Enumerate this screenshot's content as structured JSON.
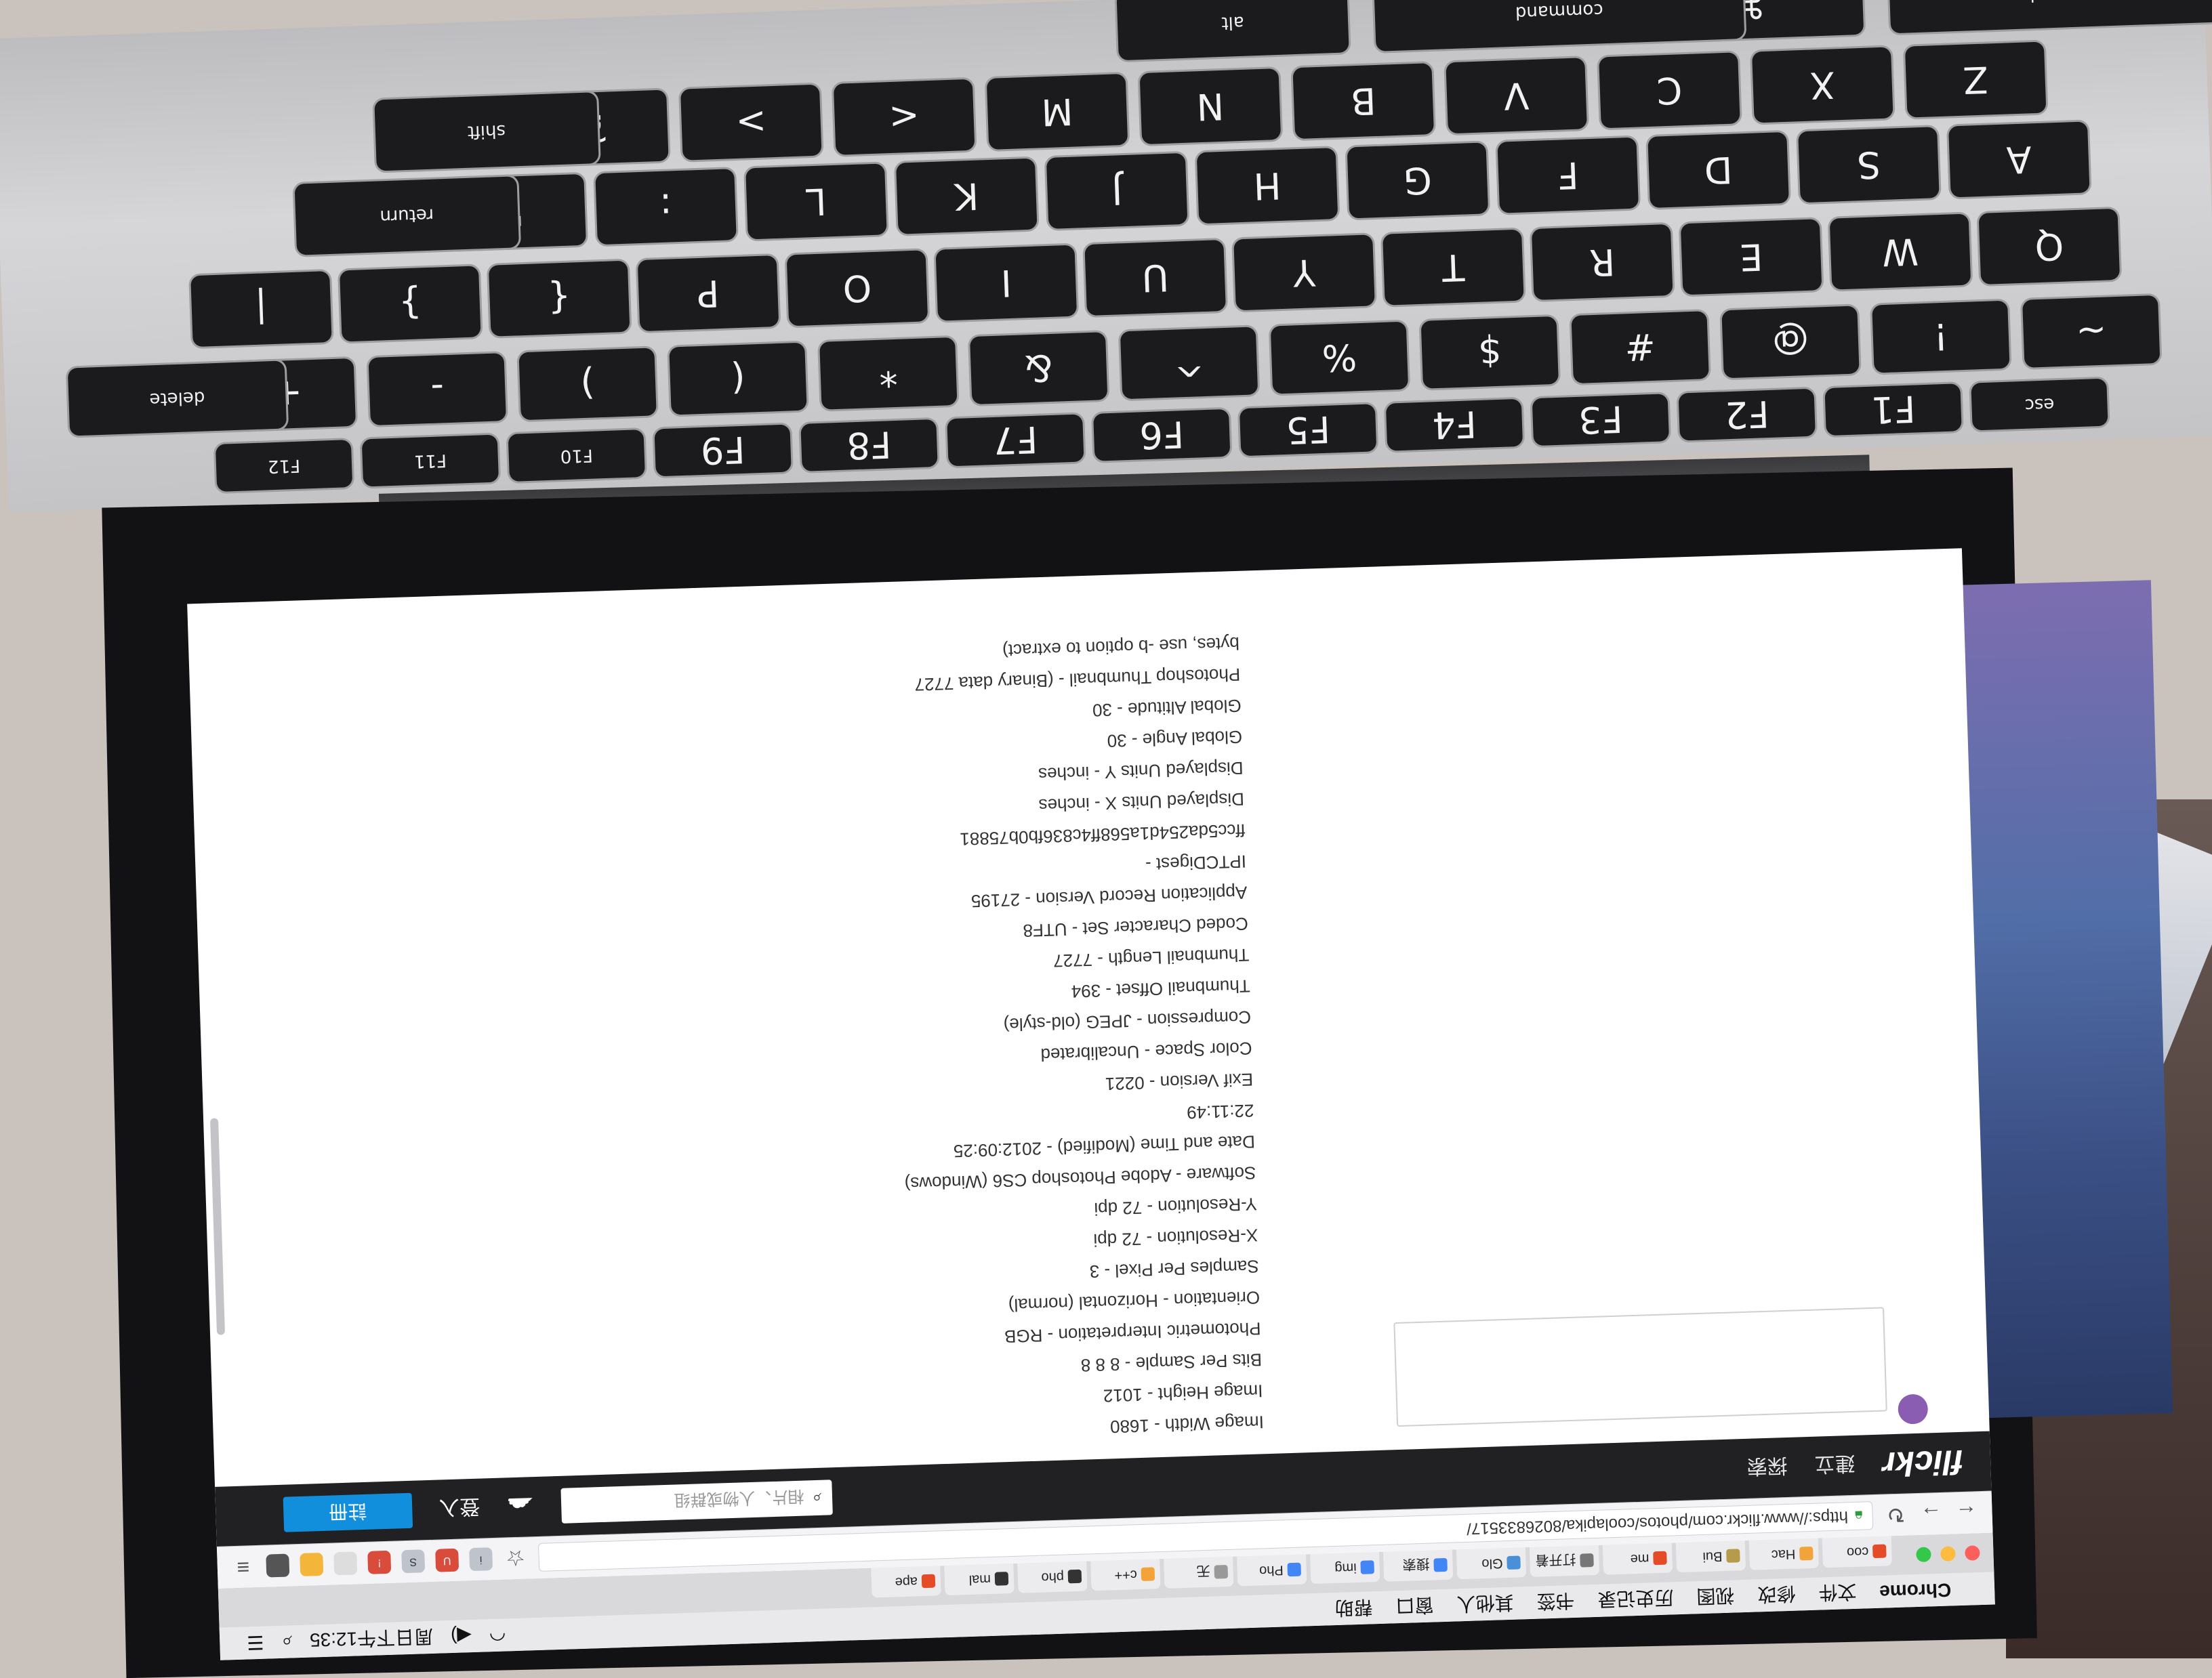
{
  "menubar": {
    "app": "Chrome",
    "items": [
      "文件",
      "修改",
      "视图",
      "历史记录",
      "书签",
      "其他人",
      "窗口",
      "帮助"
    ],
    "clock": "周日下午12:35"
  },
  "tabs": [
    {
      "label": "coo"
    },
    {
      "label": "Hac"
    },
    {
      "label": "Bui"
    },
    {
      "label": "me"
    },
    {
      "label": "打开着"
    },
    {
      "label": "Glo"
    },
    {
      "label": "搜索"
    },
    {
      "label": "img"
    },
    {
      "label": "Pho"
    },
    {
      "label": "无"
    },
    {
      "label": "c++"
    },
    {
      "label": "pho"
    },
    {
      "label": "mal"
    },
    {
      "label": "ape"
    }
  ],
  "toolbar": {
    "url": "https://www.flickr.com/photos/coolapika/8026833517/"
  },
  "flickr": {
    "logo": "flickr",
    "nav": [
      "建立",
      "探索"
    ],
    "search_placeholder": "相片、人物或群组",
    "login": "登入",
    "signup": "註冊"
  },
  "exif_lines": [
    "Image Width - 1680",
    "Image Height - 1012",
    "Bits Per Sample - 8 8 8",
    "Photometric Interpretation - RGB",
    "Orientation - Horizontal (normal)",
    "Samples Per Pixel - 3",
    "X-Resolution - 72 dpi",
    "Y-Resolution - 72 dpi",
    "Software - Adobe Photoshop CS6 (Windows)",
    "Date and Time (Modified) - 2012:09:25 22:11:49",
    "Exif Version - 0221",
    "Color Space - Uncalibrated",
    "Compression - JPEG (old-style)",
    "Thumbnail Offset - 394",
    "Thumbnail Length - 7727",
    "Coded Character Set - UTF8",
    "Application Record Version - 27195",
    "IPTCDigest - ffcc5da254d1a568ff4c836fb0b75881",
    "Displayed Units X - inches",
    "Displayed Units Y - inches",
    "Global Angle - 30",
    "Global Altitude - 30",
    "Photoshop Thumbnail - (Binary data 7727 bytes, use -b option to extract)"
  ],
  "keyboard": {
    "rows": [
      [
        "esc",
        "F1",
        "F2",
        "F3",
        "F4",
        "F5",
        "F6",
        "F7",
        "F8",
        "F9",
        "F10",
        "F11",
        "F12"
      ],
      [
        "~",
        "!",
        "@",
        "#",
        "$",
        "%",
        "^",
        "&",
        "*",
        "(",
        ")",
        "-",
        "+",
        "delete"
      ],
      [
        "Q",
        "W",
        "E",
        "R",
        "T",
        "Y",
        "U",
        "I",
        "O",
        "P",
        "{",
        "}",
        "|"
      ],
      [
        "A",
        "S",
        "D",
        "F",
        "G",
        "H",
        "J",
        "K",
        "L",
        ":",
        "\"",
        "return"
      ],
      [
        "Z",
        "X",
        "C",
        "V",
        "B",
        "N",
        "M",
        "<",
        ">",
        "?",
        "shift"
      ],
      [
        "command",
        "⌘",
        "command",
        "alt"
      ]
    ]
  },
  "colors": {
    "flickr_bar": "#212124",
    "signup_blue": "#128fdc",
    "screen_bg": "#ffffff"
  }
}
